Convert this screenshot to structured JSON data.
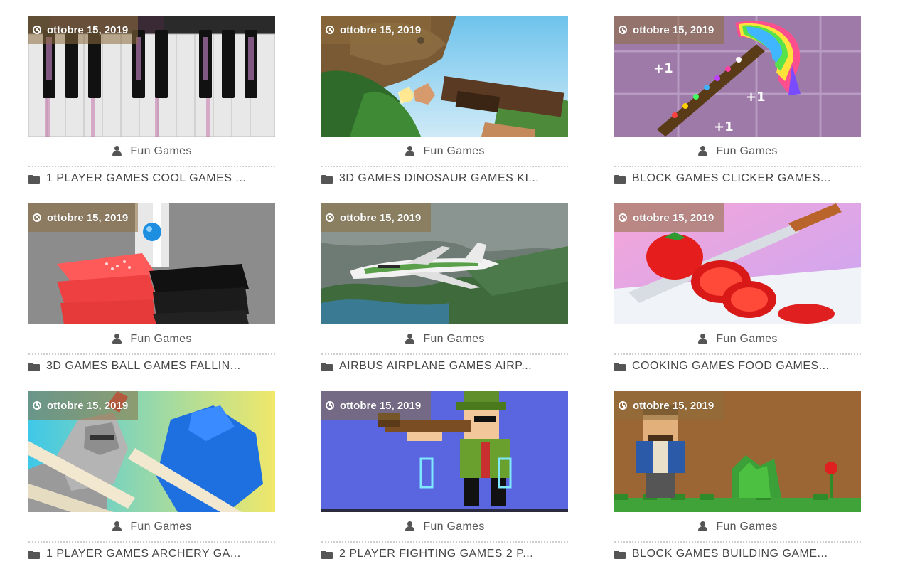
{
  "cards": [
    {
      "date": "ottobre 15, 2019",
      "author": "Fun Games",
      "categories": "1 PLAYER GAMES COOL GAMES ...",
      "thumb": "piano-tiles"
    },
    {
      "date": "ottobre 15, 2019",
      "author": "Fun Games",
      "categories": "3D GAMES DINOSAUR GAMES KI...",
      "thumb": "dinosaur-hunter"
    },
    {
      "date": "ottobre 15, 2019",
      "author": "Fun Games",
      "categories": "BLOCK GAMES CLICKER GAMES...",
      "thumb": "rainbow-pickaxe"
    },
    {
      "date": "ottobre 15, 2019",
      "author": "Fun Games",
      "categories": "3D GAMES BALL GAMES FALLIN...",
      "thumb": "helix-stack-ball"
    },
    {
      "date": "ottobre 15, 2019",
      "author": "Fun Games",
      "categories": "AIRBUS AIRPLANE GAMES AIRP...",
      "thumb": "airplane"
    },
    {
      "date": "ottobre 15, 2019",
      "author": "Fun Games",
      "categories": "COOKING GAMES FOOD GAMES...",
      "thumb": "tomato-slice"
    },
    {
      "date": "ottobre 15, 2019",
      "author": "Fun Games",
      "categories": "1 PLAYER GAMES ARCHERY GA...",
      "thumb": "knight-vs-blue"
    },
    {
      "date": "ottobre 15, 2019",
      "author": "Fun Games",
      "categories": "2 PLAYER FIGHTING GAMES 2 P...",
      "thumb": "pixel-soldier"
    },
    {
      "date": "ottobre 15, 2019",
      "author": "Fun Games",
      "categories": "BLOCK GAMES BUILDING GAME...",
      "thumb": "block-builder"
    }
  ],
  "icons": {
    "date": "clock-icon",
    "author": "user-icon",
    "categories": "folder-icon"
  },
  "colors": {
    "badge_bg": "#8c6e3c",
    "text": "#444444",
    "divider": "#cfcfcf"
  }
}
